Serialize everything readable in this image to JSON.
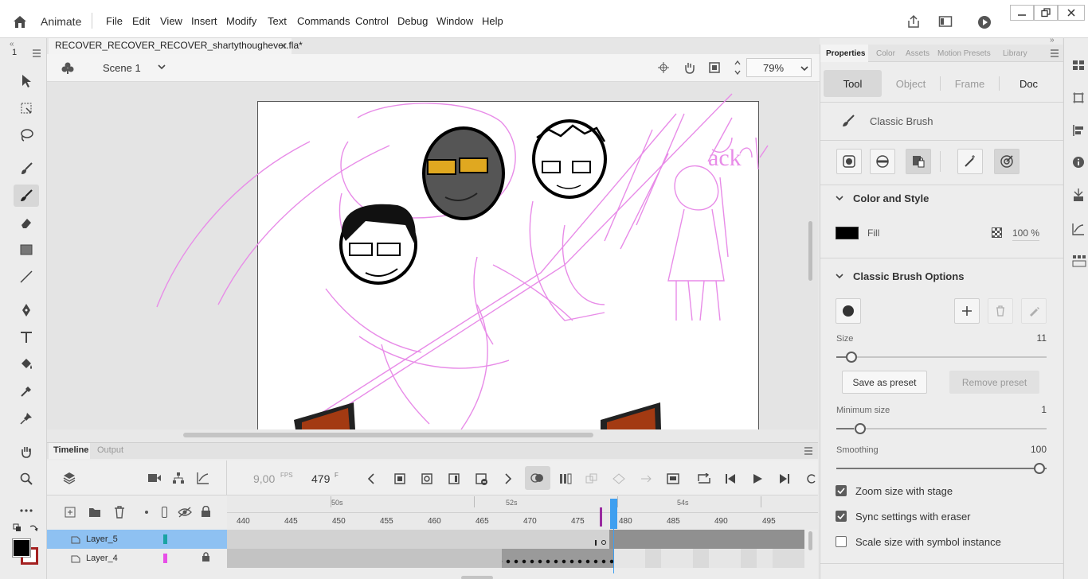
{
  "app": {
    "name": "Animate"
  },
  "menu": [
    "File",
    "Edit",
    "View",
    "Insert",
    "Modify",
    "Text",
    "Commands",
    "Control",
    "Debug",
    "Window",
    "Help"
  ],
  "document": {
    "tab_title": "RECOVER_RECOVER_RECOVER_shartythoughever.fla*",
    "scene": "Scene 1",
    "zoom": "79%"
  },
  "timeline": {
    "tabs": [
      "Timeline",
      "Output"
    ],
    "fps_value": "9,00",
    "fps_unit": "FPS",
    "frame_value": "479",
    "frame_unit": "F",
    "second_markers": [
      "50s",
      "52s",
      "54s"
    ],
    "ruler": [
      "440",
      "445",
      "450",
      "455",
      "460",
      "465",
      "470",
      "475",
      "480",
      "485",
      "490",
      "495"
    ],
    "layers": [
      {
        "name": "Layer_5",
        "color": "#1aa3a3",
        "selected": true
      },
      {
        "name": "Layer_4",
        "color": "#e74fe7",
        "locked": true
      }
    ]
  },
  "properties": {
    "tabs": [
      "Properties",
      "Color",
      "Assets",
      "Motion Presets",
      "Library"
    ],
    "segments": [
      "Tool",
      "Object",
      "Frame",
      "Doc"
    ],
    "tool_name": "Classic Brush",
    "color_style": {
      "title": "Color and Style",
      "fill_label": "Fill",
      "fill_color": "#000000",
      "alpha": "100 %"
    },
    "brush_options": {
      "title": "Classic Brush Options",
      "size_label": "Size",
      "size_value": "11",
      "save_preset": "Save as preset",
      "remove_preset": "Remove preset",
      "min_size_label": "Minimum size",
      "min_size_value": "1",
      "smoothing_label": "Smoothing",
      "smoothing_value": "100",
      "checks": [
        {
          "label": "Zoom size with stage",
          "checked": true
        },
        {
          "label": "Sync settings with eraser",
          "checked": true
        },
        {
          "label": "Scale size with symbol instance",
          "checked": false
        }
      ]
    }
  },
  "left_toolbar": {
    "misc_label": "1"
  },
  "stage_text": "ack"
}
